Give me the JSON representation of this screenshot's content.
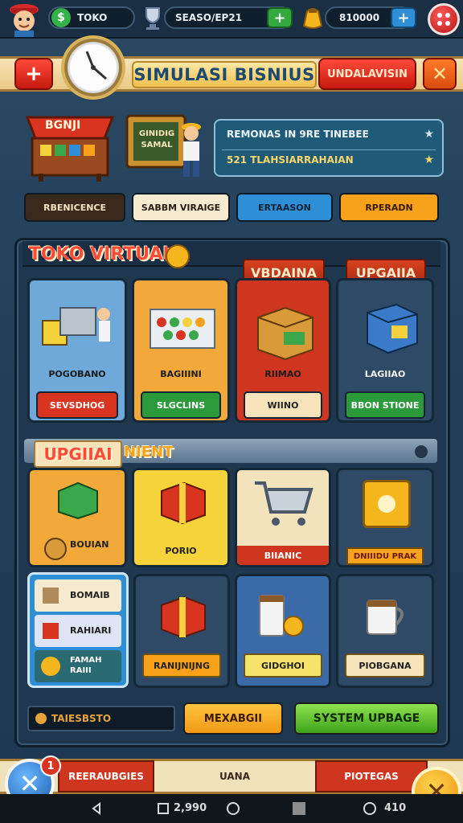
{
  "topbar": {
    "shop_label": "TOKO",
    "season_label": "SEASO/EP21",
    "gold_value": "810000",
    "plus_icon": "+",
    "menu_icon": "dots-grid-icon"
  },
  "header": {
    "title": "SIMULASI BISNIUS",
    "add_label": "+",
    "red_button": "UNDALAVISIN",
    "close_label": "✕"
  },
  "shop_sign": {
    "awning": "BGNJI",
    "board_line1": "GINIDIG",
    "board_line2": "SAMAL"
  },
  "info_card": {
    "line1": "REMONAS IN 9RE TINEBEE",
    "line2": "521 TLAHSIARRAHAIAN"
  },
  "tabs": [
    {
      "label": "RBENICENCE",
      "bg": "#3a2a1c",
      "fg": "#f3e3c2"
    },
    {
      "label": "SABBM VIRAIGE",
      "bg": "#f6ead0",
      "fg": "#2b1e10"
    },
    {
      "label": "ERTAASON",
      "bg": "#2f8fd6",
      "fg": "#0b2237"
    },
    {
      "label": "RPERADN",
      "bg": "#f7a21a",
      "fg": "#3a1b00"
    }
  ],
  "section1": {
    "title": "TOKO VIRTUALA",
    "ribbon_a": "VBDAINA",
    "ribbon_b": "UPGAIIA",
    "cards": [
      {
        "label": "POGOBANO",
        "button": "SEVSDHOG",
        "bg": "#6ea9d9",
        "btn": "#d9341f"
      },
      {
        "label": "BAGIIINI",
        "button": "SLGCLINS",
        "bg": "#f3a93a",
        "btn": "#2c9a3a"
      },
      {
        "label": "RIIMAO",
        "button": "WIINO",
        "bg": "#cf3620",
        "btn": "#f6e3b9"
      },
      {
        "label": "LAGIIAO",
        "button": "BBON  STIONE",
        "bg": "#2e4a66",
        "btn": "#2c9a3a"
      }
    ]
  },
  "section2": {
    "title": "UPGIIAI",
    "subtitle": "NIENT",
    "tiles_row1": [
      {
        "label": "BOUIAN",
        "bg": "#f3a93a"
      },
      {
        "label": "PORIO",
        "bg": "#f7d33b"
      },
      {
        "label": "BIIANIC",
        "bg": "#f3e3bd"
      },
      {
        "label": "DNIIIDU  PRAK",
        "bg": "#2e4a66"
      }
    ],
    "list_items": [
      "BOMAIB",
      "RAHIARI",
      "FAMAH RAIII"
    ],
    "tiles_row2": [
      {
        "label": "RANIJNIJNG",
        "bg": "#2e4a66"
      },
      {
        "label": "GIDGHOI",
        "bg": "#3b6aa8"
      },
      {
        "label": "PIOBGANA",
        "bg": "#2e4a66"
      }
    ]
  },
  "footer_panel": {
    "code": "TAIESBSTO",
    "btn_orange": "MEXABGII",
    "btn_green": "SYSTEM UPBAGE"
  },
  "bottom_nav": {
    "left": "REERAUBGIES",
    "middle": "UANA",
    "right": "PIOTEGAS",
    "badge": "1"
  },
  "system_bar": {
    "center_value": "2,990",
    "right_value": "410"
  }
}
